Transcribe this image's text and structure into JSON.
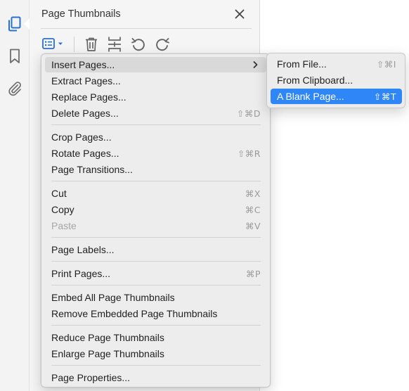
{
  "colors": {
    "highlight": "#2f86f6",
    "menu_bg": "#ececec",
    "rail_icon": "#2b70c9"
  },
  "left_rail": {
    "icons": [
      "page-thumbnails-icon",
      "bookmark-icon",
      "attachment-icon"
    ]
  },
  "panel": {
    "title": "Page Thumbnails",
    "toolbar": [
      "options-menu-icon",
      "trash-icon",
      "insert-page-icon",
      "rotate-ccw-icon",
      "rotate-cw-icon"
    ]
  },
  "menu": {
    "items": [
      {
        "label": "Insert Pages...",
        "shortcut": "",
        "submenu": true,
        "enabled": true,
        "active": true
      },
      {
        "label": "Extract Pages...",
        "shortcut": "",
        "enabled": true
      },
      {
        "label": "Replace Pages...",
        "shortcut": "",
        "enabled": true
      },
      {
        "label": "Delete Pages...",
        "shortcut": "⇧⌘D",
        "enabled": true
      },
      {
        "label": "Crop Pages...",
        "shortcut": "",
        "enabled": true
      },
      {
        "label": "Rotate Pages...",
        "shortcut": "⇧⌘R",
        "enabled": true
      },
      {
        "label": "Page Transitions...",
        "shortcut": "",
        "enabled": true
      },
      {
        "label": "Cut",
        "shortcut": "⌘X",
        "enabled": true
      },
      {
        "label": "Copy",
        "shortcut": "⌘C",
        "enabled": true
      },
      {
        "label": "Paste",
        "shortcut": "⌘V",
        "enabled": false
      },
      {
        "label": "Page Labels...",
        "shortcut": "",
        "enabled": true
      },
      {
        "label": "Print Pages...",
        "shortcut": "⌘P",
        "enabled": true
      },
      {
        "label": "Embed All Page Thumbnails",
        "shortcut": "",
        "enabled": true
      },
      {
        "label": "Remove Embedded Page Thumbnails",
        "shortcut": "",
        "enabled": true
      },
      {
        "label": "Reduce Page Thumbnails",
        "shortcut": "",
        "enabled": true
      },
      {
        "label": "Enlarge Page Thumbnails",
        "shortcut": "",
        "enabled": true
      },
      {
        "label": "Page Properties...",
        "shortcut": "",
        "enabled": true
      }
    ]
  },
  "submenu": {
    "items": [
      {
        "label": "From File...",
        "shortcut": "⇧⌘I"
      },
      {
        "label": "From Clipboard...",
        "shortcut": ""
      },
      {
        "label": "A Blank Page...",
        "shortcut": "⇧⌘T",
        "highlighted": true
      }
    ]
  }
}
